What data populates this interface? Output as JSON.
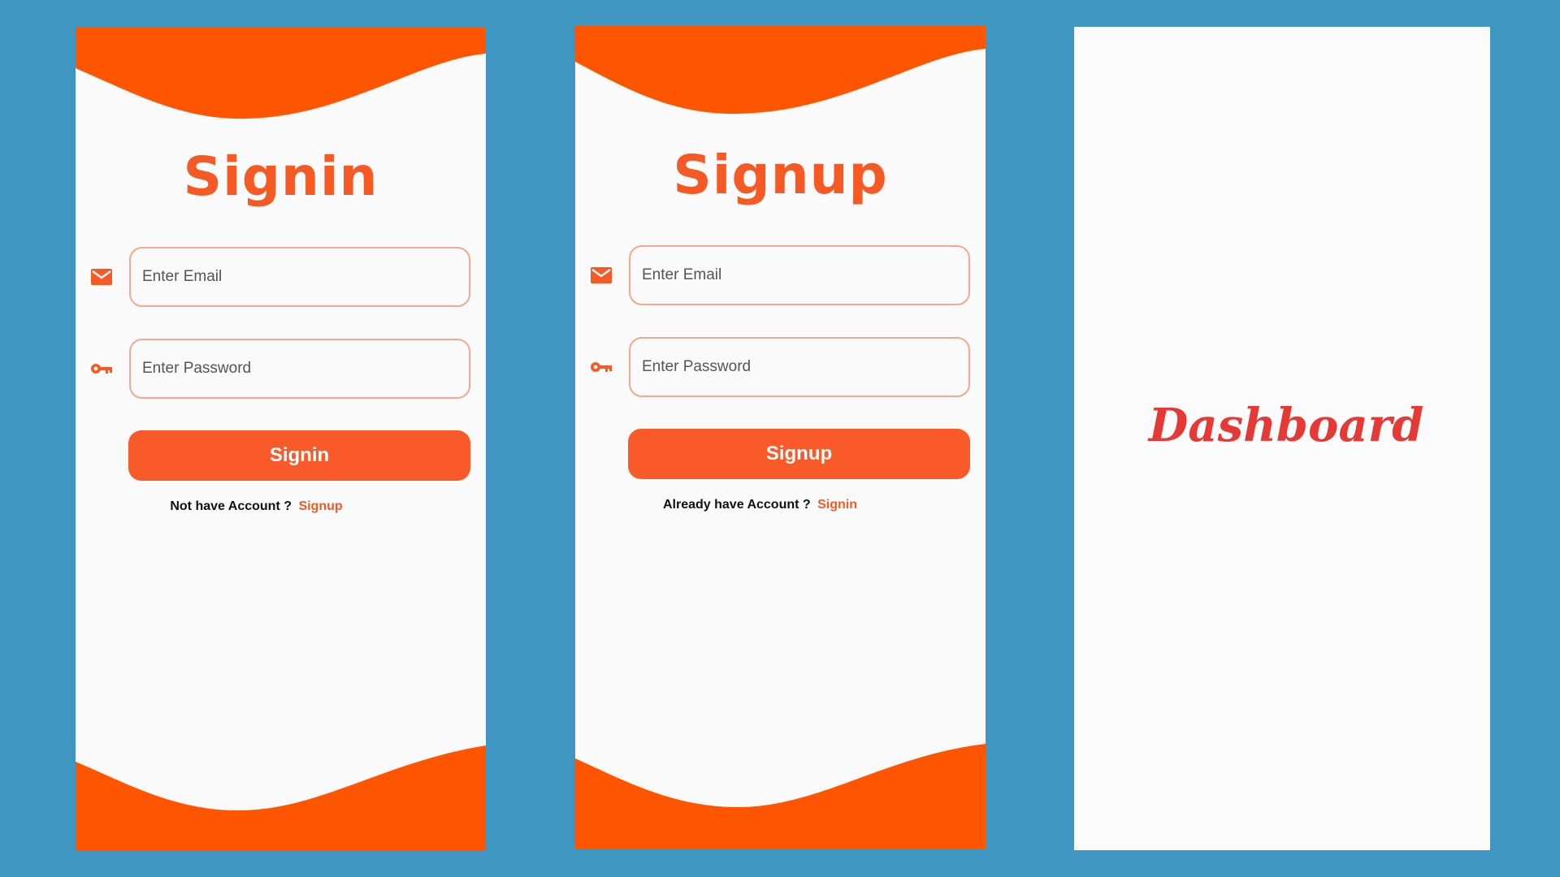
{
  "colors": {
    "background": "#4096c3",
    "accent": "#fa5a2a",
    "wave": "#ff5500",
    "dashboard_text": "#e53935"
  },
  "signin_screen": {
    "title": "Signin",
    "email": {
      "icon": "mail-icon",
      "placeholder": "Enter Email",
      "value": ""
    },
    "password": {
      "icon": "key-icon",
      "placeholder": "Enter Password",
      "value": ""
    },
    "button_label": "Signin",
    "prompt_text": "Not have Account ?",
    "prompt_link": "Signup"
  },
  "signup_screen": {
    "title": "Signup",
    "email": {
      "icon": "mail-icon",
      "placeholder": "Enter Email",
      "value": ""
    },
    "password": {
      "icon": "key-icon",
      "placeholder": "Enter Password",
      "value": ""
    },
    "button_label": "Signup",
    "prompt_text": "Already have Account ?",
    "prompt_link": "Signin"
  },
  "dashboard_screen": {
    "title": "Dashboard"
  }
}
